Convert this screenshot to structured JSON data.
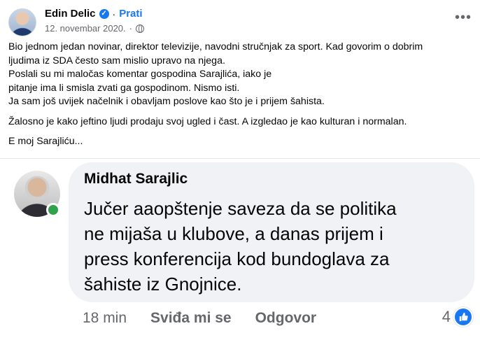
{
  "post": {
    "author": "Edin Delic",
    "separator": "·",
    "follow_label": "Prati",
    "date": "12. novembar 2020.",
    "meta_separator": "·",
    "paragraphs": [
      [
        "Bio jednom jedan novinar, direktor televizije, navodni stručnjak za sport. Kad govorim o dobrim",
        "ljudima iz SDA često sam mislio upravo na njega.",
        "Poslali su mi maločas komentar gospodina Sarajlića, iako je",
        "pitanje ima li smisla zvati ga gospodinom. Nismo isti.",
        "Ja sam još uvijek načelnik i obavljam poslove kao što je i prijem šahista."
      ],
      [
        "Žalosno je kako jeftino ljudi prodaju svoj ugled i čast. A izgledao je kao kulturan i normalan."
      ],
      [
        "E moj Sarajliću..."
      ]
    ]
  },
  "comment": {
    "author": "Midhat Sarajlic",
    "lines": [
      "Jučer aaopštenje saveza da se politika",
      "ne mijaša u klubove, a danas prijem i",
      "press konferencija kod bundoglava za",
      "šahiste iz Gnojnice."
    ],
    "time": "18 min",
    "like_label": "Sviđa mi se",
    "reply_label": "Odgovor",
    "reaction_count": "4"
  },
  "colors": {
    "accent": "#1877f2",
    "bubble": "#f0f2f5",
    "online": "#31a24c",
    "muted": "#65676b"
  },
  "icons": [
    "verified-badge-icon",
    "globe-icon",
    "more-options-icon",
    "like-reaction-icon"
  ]
}
